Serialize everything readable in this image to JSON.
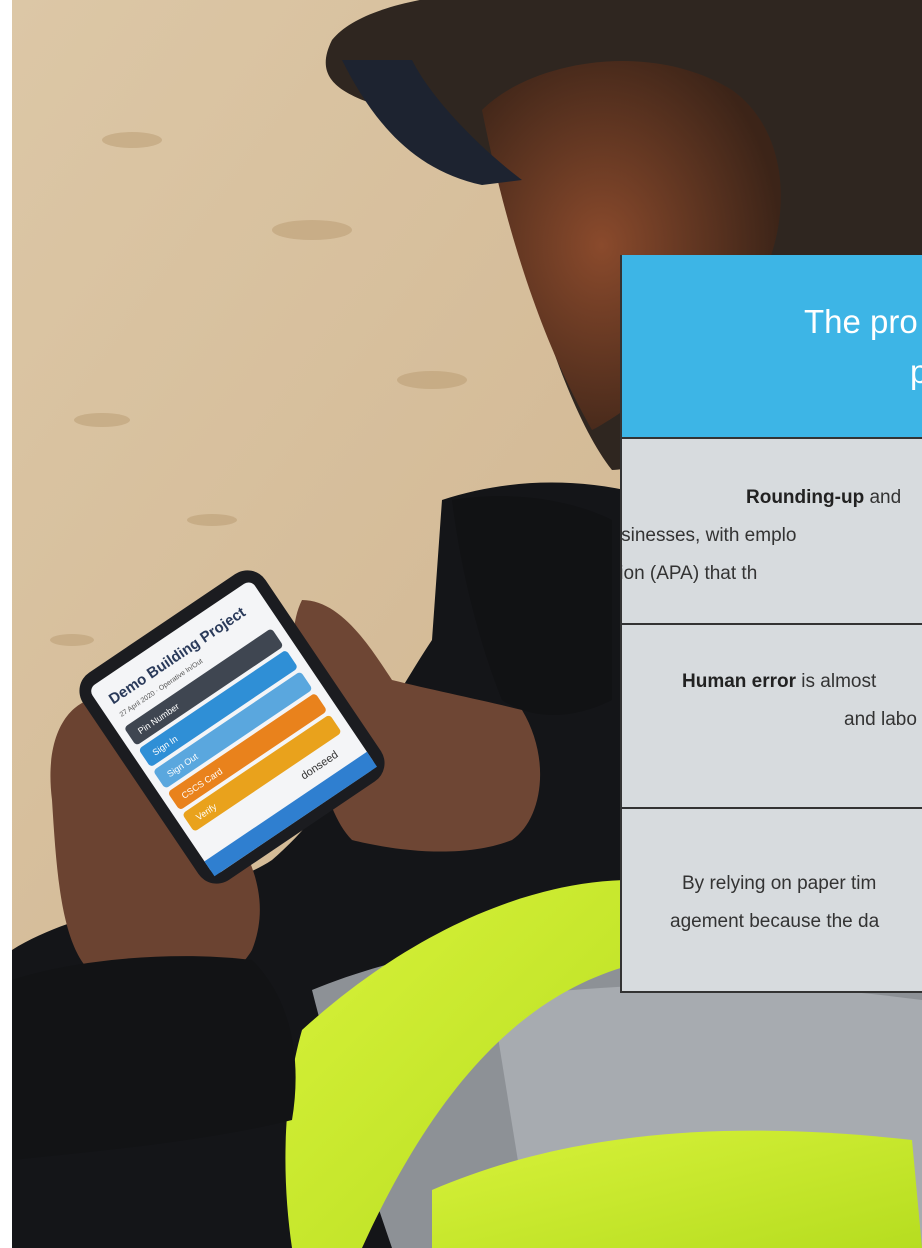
{
  "card": {
    "title_line1": "The pro",
    "title_line2": "p",
    "row1": {
      "strong": "Rounding-up",
      "line1_rest": " and",
      "line2": "businesses, with emplo",
      "line3": "tion (APA) that th"
    },
    "row2": {
      "strong": "Human error",
      "line1_rest": " is almost",
      "line2": "and labo"
    },
    "row3": {
      "line1": "By relying on paper tim",
      "line2": "agement because the da"
    }
  },
  "phone": {
    "project_title": "Demo Building Project",
    "subtitle": "27 April 2020 · Operative In/Out",
    "buttons": [
      {
        "label": "Pin Number",
        "color": "#3f4651"
      },
      {
        "label": "Sign In",
        "color": "#2f8fd6"
      },
      {
        "label": "Sign Out",
        "color": "#5aa7de"
      },
      {
        "label": "CSCS Card",
        "color": "#e9821c"
      },
      {
        "label": "Verify",
        "color": "#e9a21c"
      }
    ],
    "brand": "donseed"
  },
  "colors": {
    "card_header": "#3db5e6",
    "card_body": "#d7dbde",
    "hi_vis": "#c8ee2a"
  }
}
